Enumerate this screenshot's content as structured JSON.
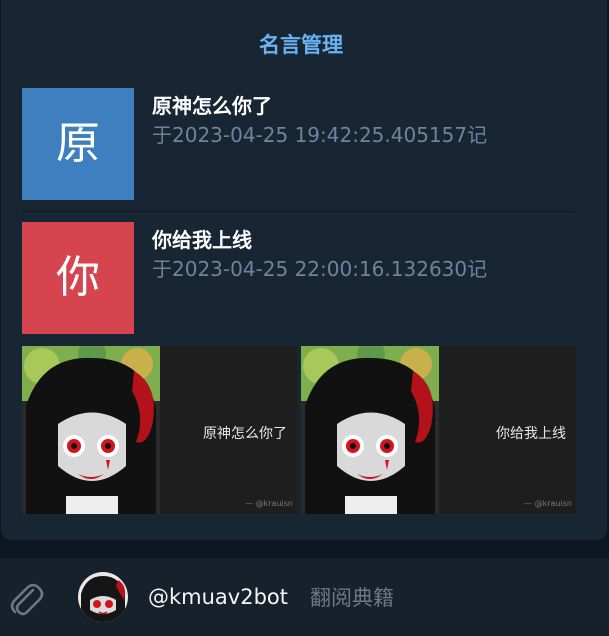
{
  "card": {
    "title": "名言管理",
    "entries": [
      {
        "initial": "原",
        "title": "原神怎么你了",
        "subtitle": "于2023-04-25 19:42:25.405157记",
        "tile_color": "#3e7fc0"
      },
      {
        "initial": "你",
        "title": "你给我上线",
        "subtitle": "于2023-04-25 22:00:16.132630记",
        "tile_color": "#d6444f"
      }
    ],
    "thumbnails": [
      {
        "quote": "原神怎么你了",
        "credit": "— @krauisn"
      },
      {
        "quote": "你给我上线",
        "credit": "— @krauisn"
      }
    ]
  },
  "input_bar": {
    "attach_icon": "paperclip-icon",
    "bot_handle": "@kmuav2bot",
    "placeholder": "翻阅典籍"
  },
  "colors": {
    "background": "#0e1621",
    "card": "#182533",
    "accent": "#6ab2f2",
    "muted_text": "#708499",
    "input_bar": "#17212b"
  }
}
